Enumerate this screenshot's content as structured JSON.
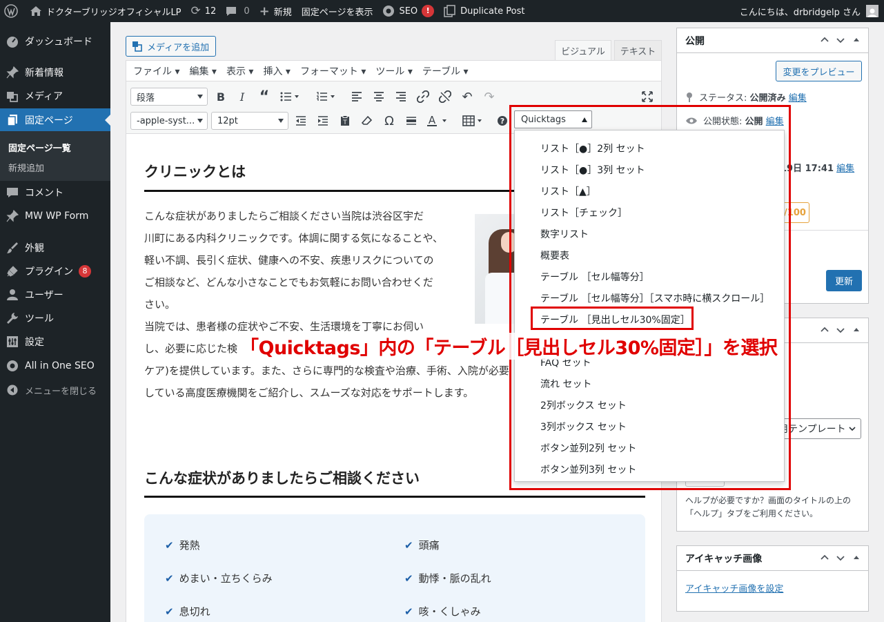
{
  "adminbar": {
    "site_name": "ドクターブリッジオフィシャルLP",
    "updates_count": "12",
    "comments_count": "0",
    "new_label": "新規",
    "view_page": "固定ページを表示",
    "seo_label": "SEO",
    "seo_badge": "!",
    "duplicate_post": "Duplicate Post",
    "greeting": "こんにちは、drbridgelp さん"
  },
  "sidebar": {
    "items": [
      {
        "label": "ダッシュボード",
        "icon": "dashboard-icon"
      },
      {
        "label": "新着情報",
        "icon": "pin-icon"
      },
      {
        "label": "メディア",
        "icon": "media-icon"
      },
      {
        "label": "固定ページ",
        "icon": "page-icon"
      },
      {
        "label": "コメント",
        "icon": "comment-icon"
      },
      {
        "label": "MW WP Form",
        "icon": "pin-icon"
      },
      {
        "label": "外観",
        "icon": "brush-icon"
      },
      {
        "label": "プラグイン",
        "icon": "plugin-icon",
        "badge": "8"
      },
      {
        "label": "ユーザー",
        "icon": "user-icon"
      },
      {
        "label": "ツール",
        "icon": "wrench-icon"
      },
      {
        "label": "設定",
        "icon": "settings-icon"
      },
      {
        "label": "All in One SEO",
        "icon": "gear-icon"
      }
    ],
    "submenu": [
      "固定ページ一覧",
      "新規追加"
    ],
    "collapse": "メニューを閉じる"
  },
  "editor": {
    "add_media": "メディアを追加",
    "tab_visual": "ビジュアル",
    "tab_text": "テキスト",
    "menubar": [
      "ファイル ▾",
      "編集 ▾",
      "表示 ▾",
      "挿入 ▾",
      "フォーマット ▾",
      "ツール ▾",
      "テーブル ▾"
    ],
    "format_select": "段落",
    "font_select": "-apple-syst...",
    "size_select": "12pt",
    "quicktags_select": "Quicktags"
  },
  "content": {
    "heading1": "クリニックとは",
    "para_lines": [
      "こんな症状がありましたらご相談ください当院は渋谷区宇だ",
      "川町にある内科クリニックです。体調に関する気になることや、",
      "軽い不調、長引く症状、健康への不安、疾患リスクについての",
      "ご相談など、どんな小さなことでもお気軽にお問い合わせくだ",
      "さい。",
      "当院では、患者様の症状やご不安、生活環境を丁寧にお伺い",
      "し、必要に応じた検",
      "ケア)を提供しています。また、さらに専門的な検査や治療、手術、入院が必要",
      "している高度医療機関をご紹介し、スムーズな対応をサポートします。"
    ],
    "heading2": "こんな症状がありましたらご相談ください",
    "symptoms": [
      "発熱",
      "頭痛",
      "めまい・立ちくらみ",
      "動悸・脈の乱れ",
      "息切れ",
      "咳・くしゃみ"
    ]
  },
  "quicktags_menu": [
    "リスト［●］2列 セット",
    "リスト［●］3列 セット",
    "リスト［▲］",
    "リスト［チェック］",
    "数字リスト",
    "概要表",
    "テーブル ［セル幅等分］",
    "テーブル ［セル幅等分］［スマホ時に横スクロール］",
    "テーブル ［見出しセル30%固定］",
    "",
    "FAQ セット",
    "流れ セット",
    "2列ボックス セット",
    "3列ボックス セット",
    "ボタン並列2列 セット",
    "ボタン並列3列 セット"
  ],
  "publish_box": {
    "title": "公開",
    "preview_button": "変更をプレビュー",
    "status_label": "ステータス:",
    "status_value": "公開済み",
    "visibility_label": "公開状態:",
    "visibility_value": "公開",
    "edit": "編集",
    "date_fragment": "19日 17:41",
    "score_fragment": "/100",
    "update_button": "更新"
  },
  "attributes_box": {
    "template_fragment": "用テンプレート",
    "help_text": "ヘルプが必要ですか？画面のタイトルの上の「ヘルプ」タブをご利用ください。"
  },
  "featured_box": {
    "title": "アイキャッチ画像",
    "set_link": "アイキャッチ画像を設定"
  },
  "annotation": {
    "callout": "「Quicktags」内の「テーブル［見出しセル30%固定］」を選択"
  },
  "colors": {
    "admin_dark": "#1d2327",
    "accent": "#2271b1",
    "annotation_red": "#e00000"
  }
}
